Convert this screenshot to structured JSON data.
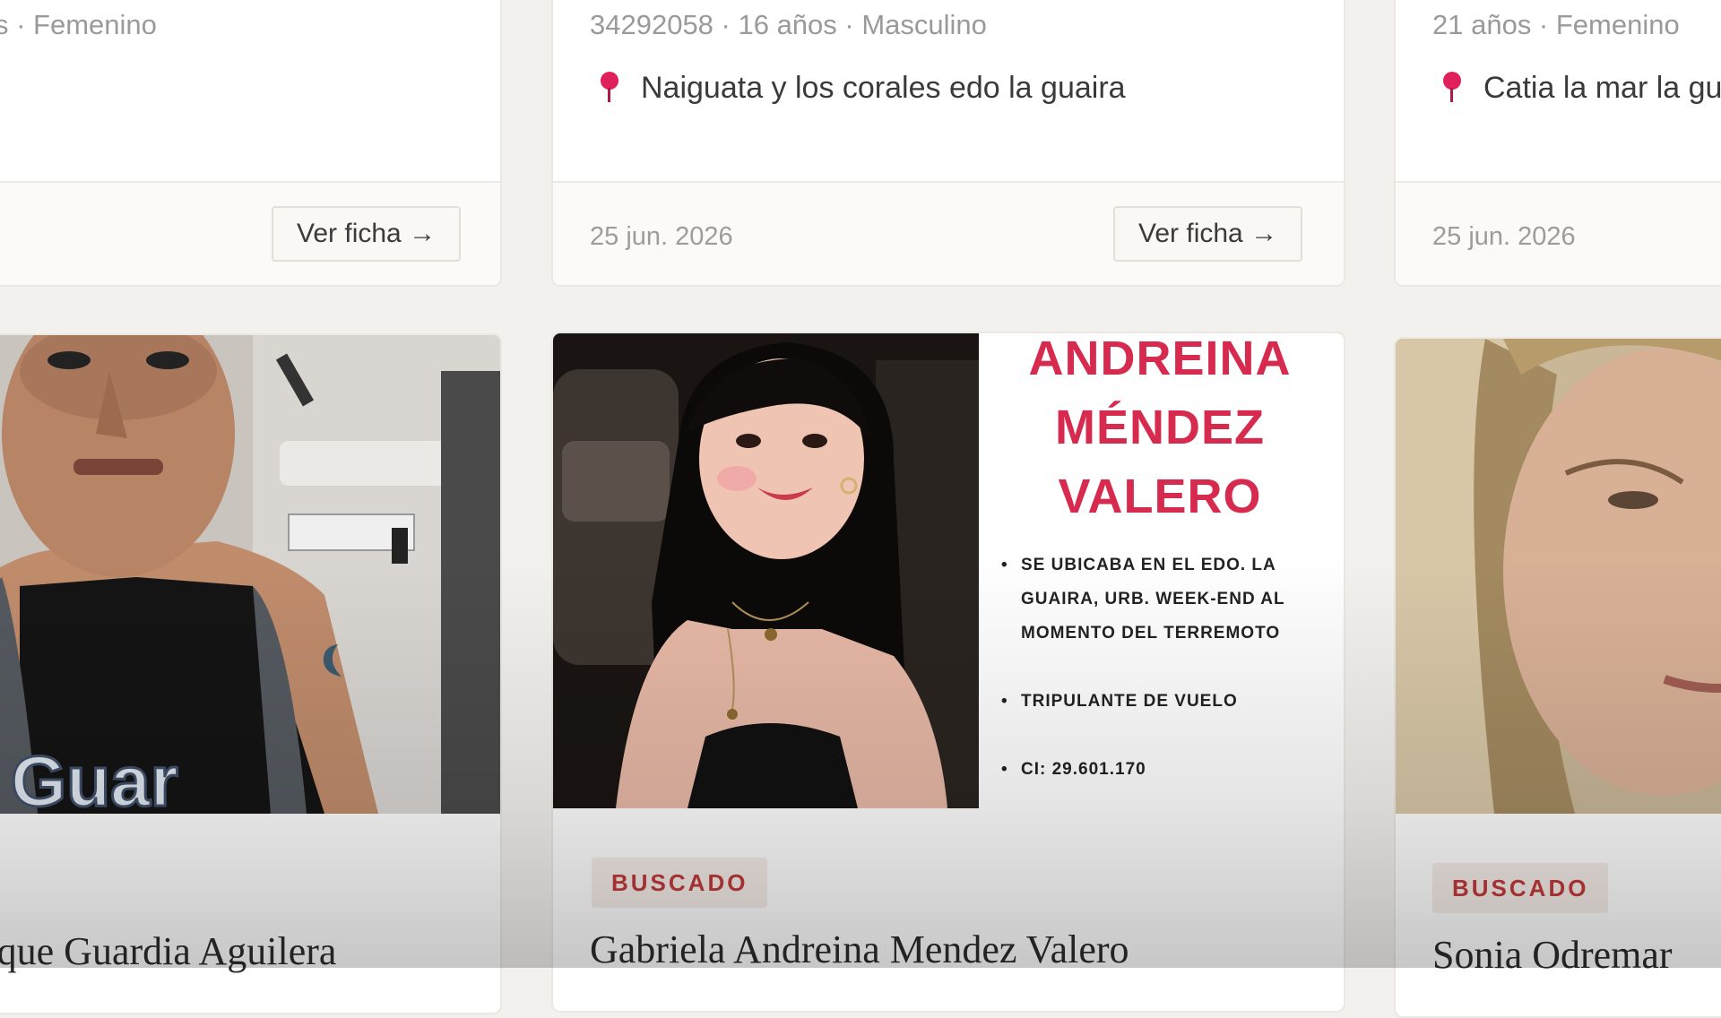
{
  "cards_top": [
    {
      "meta": "s · Femenino",
      "button": "Ver ficha →"
    },
    {
      "meta": "34292058 · 16 años · Masculino",
      "location": "Naiguata y los corales edo la guaira",
      "date": "25 jun. 2026",
      "button": "Ver ficha →"
    },
    {
      "meta": "21 años · Femenino",
      "location": "Catia la mar la gu",
      "date": "25 jun. 2026"
    }
  ],
  "cards_bottom": [
    {
      "name": "rque Guardia Aguilera",
      "shirt_text": "Guar"
    },
    {
      "poster_title_lines": [
        "ANDREINA",
        "MÉNDEZ",
        "VALERO"
      ],
      "poster_bullets": [
        "SE UBICABA EN EL EDO. LA GUAIRA, URB. WEEK-END AL MOMENTO DEL TERREMOTO",
        "TRIPULANTE DE VUELO",
        "CI: 29.601.170"
      ],
      "badge": "BUSCADO",
      "name": "Gabriela Andreina Mendez Valero"
    },
    {
      "badge": "BUSCADO",
      "name": "Sonia Odremar"
    }
  ],
  "colors": {
    "page_bg": "#f3f1ee",
    "accent": "#d62a4e",
    "badge_text": "#c23a3a",
    "pin": "#e0205a"
  }
}
